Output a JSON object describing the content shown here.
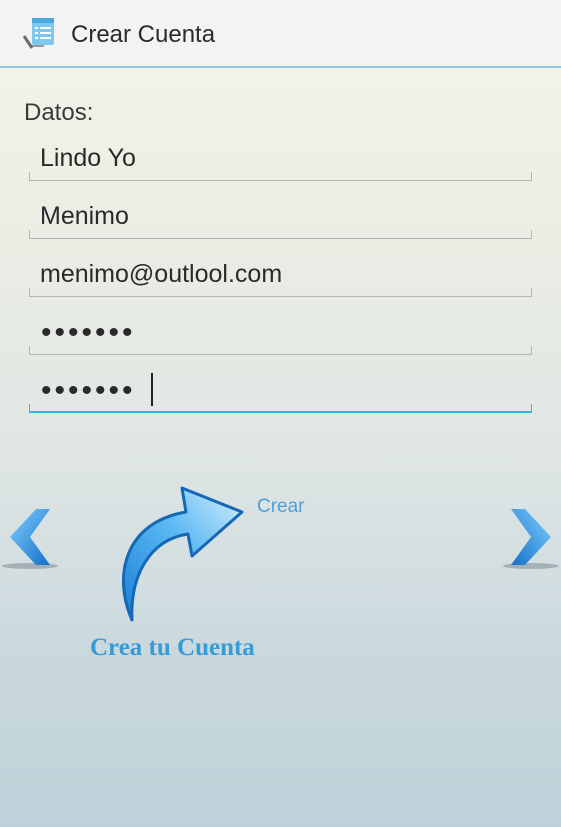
{
  "action_bar": {
    "icon": "notepad-checklist-icon",
    "title": "Crear Cuenta"
  },
  "form": {
    "section_label": "Datos:",
    "first_name": "Lindo Yo",
    "last_name": "Menimo",
    "email": "menimo@outlool.com",
    "password_mask": "•••••••",
    "confirm_password_mask": "•••••••"
  },
  "navigation": {
    "prev_icon": "chevron-left-icon",
    "next_icon": "chevron-right-icon"
  },
  "create": {
    "arrow_icon": "curved-arrow-icon",
    "link_label": "Crear",
    "caption": "Crea tu Cuenta"
  },
  "colors": {
    "accent": "#33b5e5",
    "link": "#4e9fd8",
    "caption": "#3a9ad6"
  }
}
